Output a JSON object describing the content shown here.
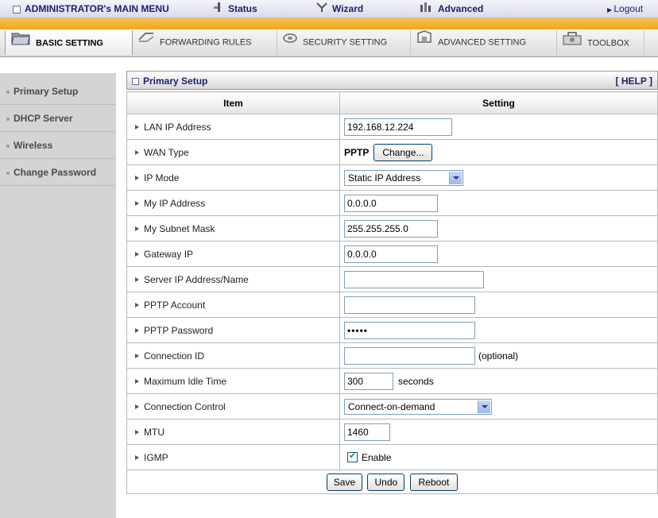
{
  "topbar": {
    "admin_menu": "ADMINISTRATOR's MAIN MENU",
    "status": "Status",
    "wizard": "Wizard",
    "advanced": "Advanced",
    "logout": "Logout"
  },
  "tabs": [
    "BASIC SETTING",
    "FORWARDING RULES",
    "SECURITY SETTING",
    "ADVANCED SETTING",
    "TOOLBOX"
  ],
  "sidebar": {
    "items": [
      "Primary Setup",
      "DHCP Server",
      "Wireless",
      "Change Password"
    ]
  },
  "panel": {
    "title": "Primary Setup",
    "help": "[ HELP ]",
    "col_item": "Item",
    "col_setting": "Setting"
  },
  "rows": {
    "lan_ip": {
      "label": "LAN IP Address",
      "value": "192.168.12.224"
    },
    "wan_type": {
      "label": "WAN Type",
      "value": "PPTP",
      "button": "Change..."
    },
    "ip_mode": {
      "label": "IP Mode",
      "value": "Static IP Address"
    },
    "my_ip": {
      "label": "My IP Address",
      "value": "0.0.0.0"
    },
    "subnet": {
      "label": "My Subnet Mask",
      "value": "255.255.255.0"
    },
    "gateway": {
      "label": "Gateway IP",
      "value": "0.0.0.0"
    },
    "server": {
      "label": "Server IP Address/Name",
      "value": ""
    },
    "account": {
      "label": "PPTP Account",
      "value": ""
    },
    "password": {
      "label": "PPTP Password",
      "value": "•••••"
    },
    "conn_id": {
      "label": "Connection ID",
      "value": "",
      "suffix": "(optional)"
    },
    "idle": {
      "label": "Maximum Idle Time",
      "value": "300",
      "suffix": "seconds"
    },
    "control": {
      "label": "Connection Control",
      "value": "Connect-on-demand"
    },
    "mtu": {
      "label": "MTU",
      "value": "1460"
    },
    "igmp": {
      "label": "IGMP",
      "value": "Enable"
    }
  },
  "buttons": {
    "save": "Save",
    "undo": "Undo",
    "reboot": "Reboot"
  }
}
